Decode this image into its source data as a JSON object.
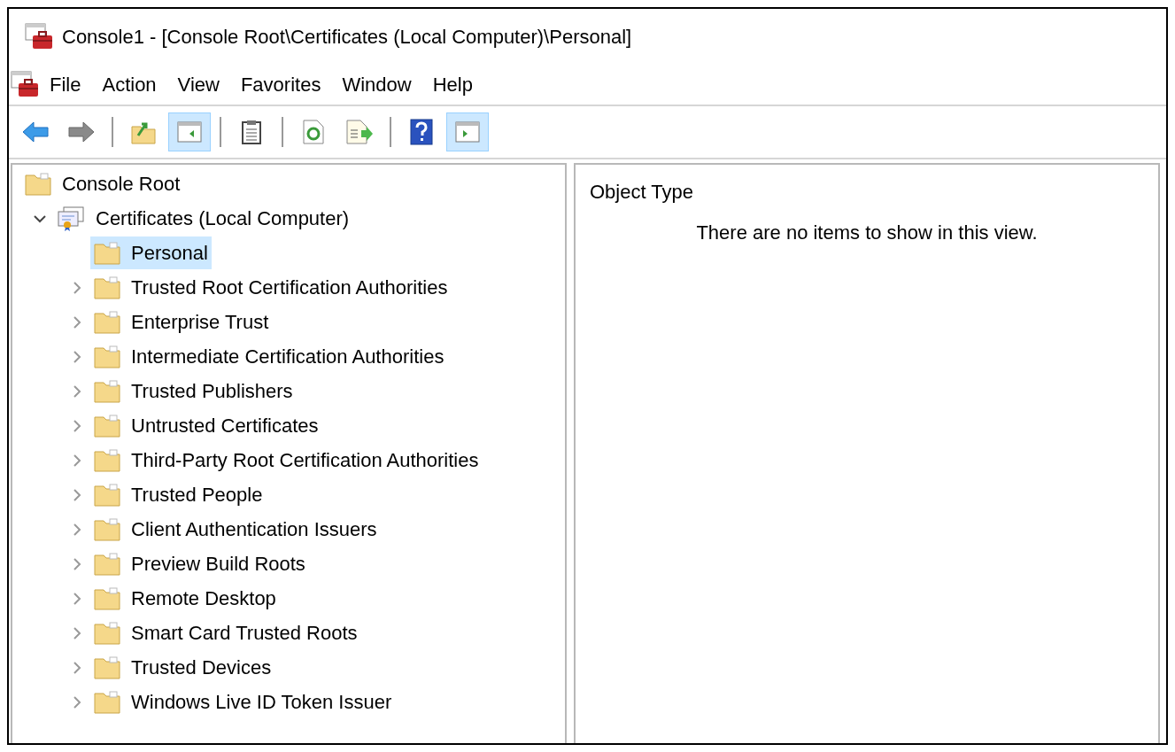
{
  "window": {
    "title": "Console1 - [Console Root\\Certificates (Local Computer)\\Personal]"
  },
  "menu": [
    "File",
    "Action",
    "View",
    "Favorites",
    "Window",
    "Help"
  ],
  "toolbar": [
    {
      "kind": "back",
      "pressed": false
    },
    {
      "kind": "forward",
      "pressed": false
    },
    {
      "kind": "separator"
    },
    {
      "kind": "up",
      "pressed": false
    },
    {
      "kind": "tree-toggle",
      "pressed": true
    },
    {
      "kind": "separator"
    },
    {
      "kind": "clipboard",
      "pressed": false
    },
    {
      "kind": "separator"
    },
    {
      "kind": "refresh",
      "pressed": false
    },
    {
      "kind": "export",
      "pressed": false
    },
    {
      "kind": "separator"
    },
    {
      "kind": "help",
      "pressed": false
    },
    {
      "kind": "action-pane",
      "pressed": true
    }
  ],
  "tree": [
    {
      "label": "Console Root",
      "kind": "folder",
      "selected": false,
      "children": [
        {
          "label": "Certificates (Local Computer)",
          "kind": "certificate",
          "expanded": true,
          "selected": false,
          "children": [
            {
              "label": "Personal",
              "kind": "folder",
              "selected": true
            },
            {
              "label": "Trusted Root Certification Authorities",
              "kind": "folder",
              "expanded": false,
              "selected": false
            },
            {
              "label": "Enterprise Trust",
              "kind": "folder",
              "expanded": false,
              "selected": false
            },
            {
              "label": "Intermediate Certification Authorities",
              "kind": "folder",
              "expanded": false,
              "selected": false
            },
            {
              "label": "Trusted Publishers",
              "kind": "folder",
              "expanded": false,
              "selected": false
            },
            {
              "label": "Untrusted Certificates",
              "kind": "folder",
              "expanded": false,
              "selected": false
            },
            {
              "label": "Third-Party Root Certification Authorities",
              "kind": "folder",
              "expanded": false,
              "selected": false
            },
            {
              "label": "Trusted People",
              "kind": "folder",
              "expanded": false,
              "selected": false
            },
            {
              "label": "Client Authentication Issuers",
              "kind": "folder",
              "expanded": false,
              "selected": false
            },
            {
              "label": "Preview Build Roots",
              "kind": "folder",
              "expanded": false,
              "selected": false
            },
            {
              "label": "Remote Desktop",
              "kind": "folder",
              "expanded": false,
              "selected": false
            },
            {
              "label": "Smart Card Trusted Roots",
              "kind": "folder",
              "expanded": false,
              "selected": false
            },
            {
              "label": "Trusted Devices",
              "kind": "folder",
              "expanded": false,
              "selected": false
            },
            {
              "label": "Windows Live ID Token Issuer",
              "kind": "folder",
              "expanded": false,
              "selected": false
            }
          ]
        }
      ]
    }
  ],
  "list": {
    "column": "Object Type",
    "empty_message": "There are no items to show in this view."
  }
}
